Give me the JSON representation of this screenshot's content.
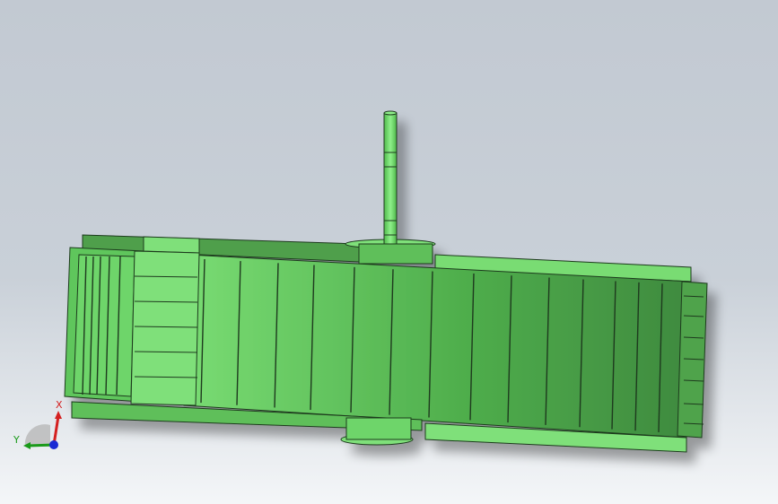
{
  "viewport": {
    "model_name": "",
    "colors": {
      "body_light": "#7fe07a",
      "body_mid": "#5fc65b",
      "body_dark": "#3f8f3d",
      "edge": "#1e3a1e",
      "background_top": "#c2c9d2",
      "background_bottom": "#f4f6f8"
    }
  },
  "triad": {
    "x_label": "X",
    "y_label": "Y",
    "x_color": "#d42020",
    "y_color": "#1a9a1a",
    "z_color": "#1a2ad4"
  }
}
